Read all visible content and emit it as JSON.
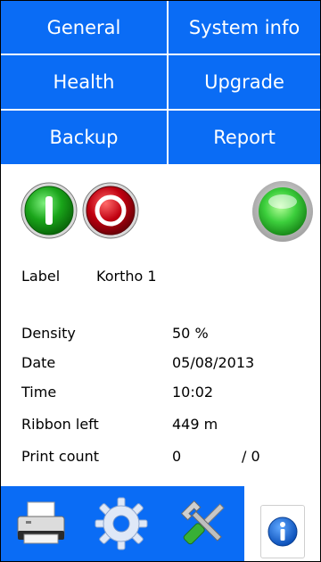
{
  "nav": {
    "general": "General",
    "system_info": "System info",
    "health": "Health",
    "upgrade": "Upgrade",
    "backup": "Backup",
    "report": "Report"
  },
  "label_row": {
    "label": "Label",
    "value": "Kortho 1"
  },
  "fields": [
    {
      "label": "Density",
      "value": "50 %"
    },
    {
      "label": "Date",
      "value": "05/08/2013"
    },
    {
      "label": "Time",
      "value": "10:02"
    },
    {
      "label": "Ribbon left",
      "value": "449 m"
    },
    {
      "label": "Print count",
      "value": "0",
      "extra": "/ 0"
    }
  ],
  "icons": {
    "start": "power-on-icon",
    "stop": "stop-icon",
    "status": "status-led-icon",
    "printer": "printer-icon",
    "settings": "gear-icon",
    "tools": "wrench-screwdriver-icon",
    "info": "info-icon"
  },
  "colors": {
    "accent_blue": "#0a6cf5",
    "start_green": "#1aa51a",
    "stop_red": "#c00010",
    "status_green": "#3ccf3c"
  }
}
